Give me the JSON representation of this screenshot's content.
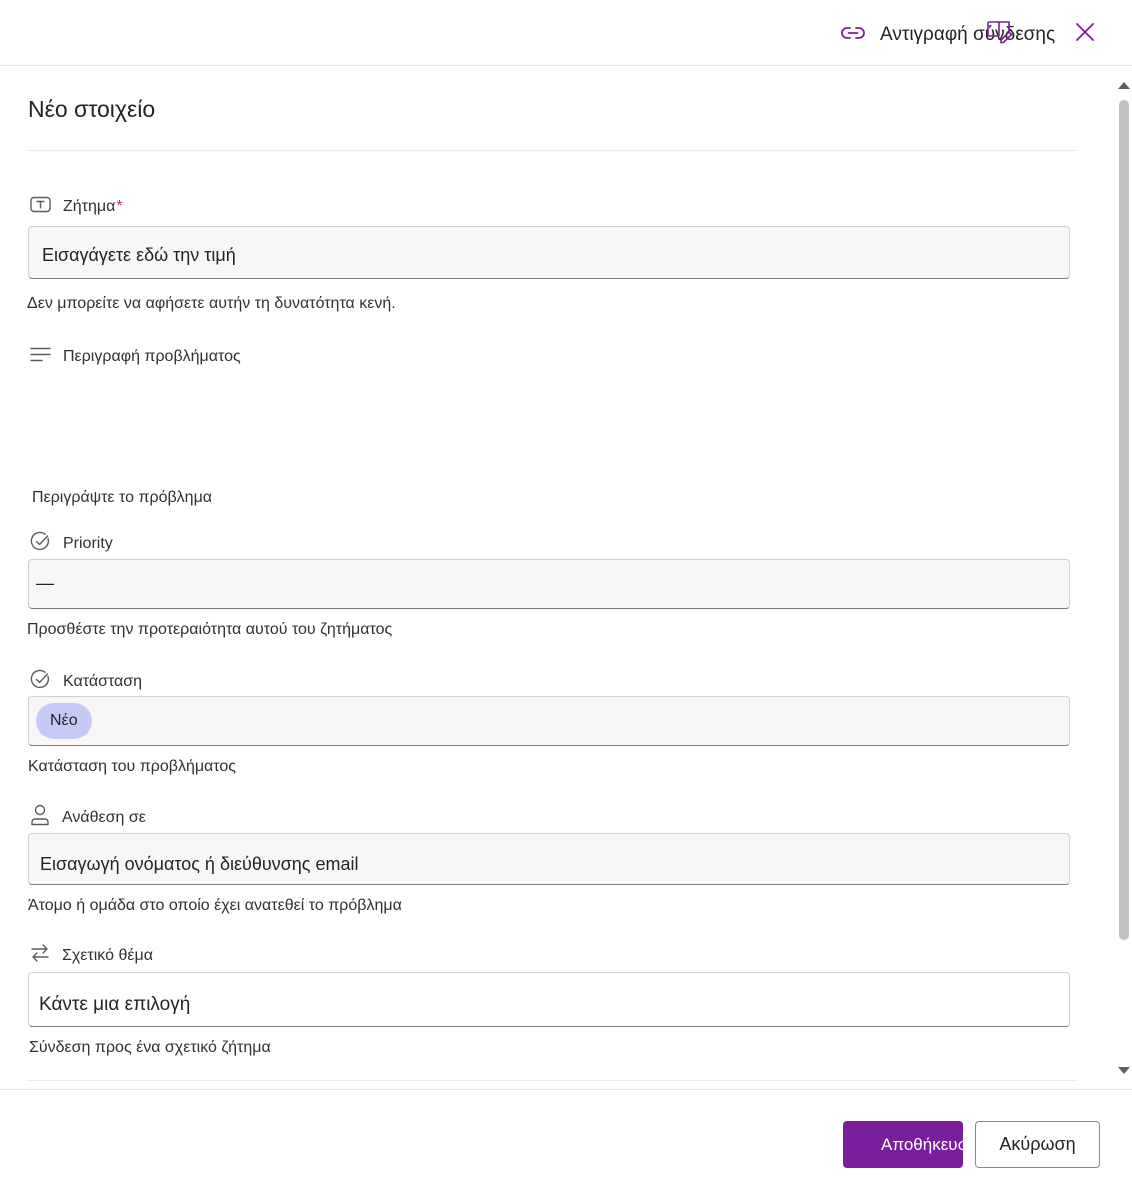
{
  "header": {
    "copy_link_label": "Αντιγραφή σύνδεσης"
  },
  "form": {
    "title": "Νέο στοιχείο",
    "issue": {
      "label": "Ζήτημα",
      "required_mark": "*",
      "placeholder": "Εισαγάγετε εδώ την τιμή",
      "error": "Δεν μπορείτε να αφήσετε αυτήν τη δυνατότητα κενή."
    },
    "description": {
      "label": "Περιγραφή προβλήματος",
      "help": "Περιγράψτε το πρόβλημα"
    },
    "priority": {
      "label": "Priority",
      "value": "—",
      "help": "Προσθέστε την προτεραιότητα αυτού του ζητήματος"
    },
    "status": {
      "label": "Κατάσταση",
      "value": "Νέο",
      "help": "Κατάσταση του προβλήματος"
    },
    "assigned": {
      "label": "Ανάθεση σε",
      "placeholder": "Εισαγωγή ονόματος ή διεύθυνσης email",
      "help": "Άτομο ή ομάδα στο οποίο έχει ανατεθεί το πρόβλημα"
    },
    "related": {
      "label": "Σχετικό θέμα",
      "placeholder": "Κάντε μια επιλογή",
      "help": "Σύνδεση προς ένα σχετικό ζήτημα"
    }
  },
  "footer": {
    "save_label": "Αποθήκευση",
    "cancel_label": "Ακύρωση"
  },
  "colors": {
    "accent": "#7b1e9c",
    "status_pill": "#c5c9f6",
    "required": "#c4314b"
  },
  "icons": [
    "link-icon",
    "edit-form-icon",
    "close-icon",
    "text-field-icon",
    "multiline-text-icon",
    "choice-check-icon",
    "person-icon",
    "lookup-arrows-icon"
  ]
}
